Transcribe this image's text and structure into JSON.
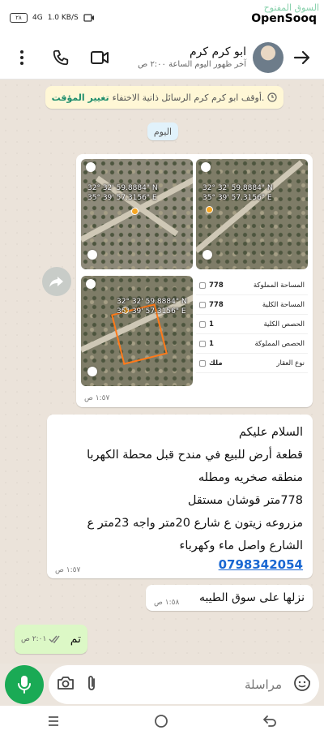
{
  "status_bar": {
    "battery": "٢٨",
    "network": "4G",
    "speed": "1.0 KB/S"
  },
  "brand": {
    "arabic": "السوق المفتوح",
    "latin": "OpenSooq"
  },
  "header": {
    "contact_name": "ابو كرم كرم",
    "last_seen": "آخر ظهور اليوم الساعة ٢:٠٠ ص"
  },
  "system_notice": {
    "text": "أوقف ابو كرم كرم الرسائل ذاتية الاختفاء.",
    "action": "تغيير المؤقت"
  },
  "day_label": "اليوم",
  "album": {
    "coords": [
      {
        "lat": "32° 32' 59.8884\" N",
        "lon": "35° 39' 57.3156\" E"
      },
      {
        "lat": "32° 32' 59.8884\" N",
        "lon": "35° 39' 57.3156\" E"
      },
      {
        "lat": "32° 32' 59.8884\" N",
        "lon": "35° 39' 57.3156\" E"
      }
    ],
    "properties": [
      {
        "label": "المساحة المملوكة",
        "value": "778"
      },
      {
        "label": "المساحة الكلية",
        "value": "778"
      },
      {
        "label": "الحصص الكلية",
        "value": "1"
      },
      {
        "label": "الحصص المملوكة",
        "value": "1"
      },
      {
        "label": "نوع العقار",
        "value": "ملك"
      }
    ],
    "time": "١:٥٧ ص"
  },
  "messages": {
    "main": {
      "lines": [
        "السلام عليكم",
        "قطعة أرض للبيع في مندح قبل محطة الكهربا",
        "منطقه صخريه ومطله",
        "778متر قوشان مستقل",
        "مزروعه زيتون ع شارع 20متر واجه 23متر ع",
        "الشارع واصل ماء وكهرباء"
      ],
      "phone": "0798342054",
      "time": "١:٥٧ ص"
    },
    "short": {
      "text": "نزلها على سوق الطيبه",
      "time": "١:٥٨ ص"
    },
    "outgoing": {
      "text": "تم",
      "time": "٢:٠١ ص"
    }
  },
  "composer": {
    "placeholder": "مراسلة"
  },
  "colors": {
    "accent_green": "#1aaa55",
    "outgoing_bubble": "#dcf8c6",
    "link_blue": "#1967d2"
  }
}
